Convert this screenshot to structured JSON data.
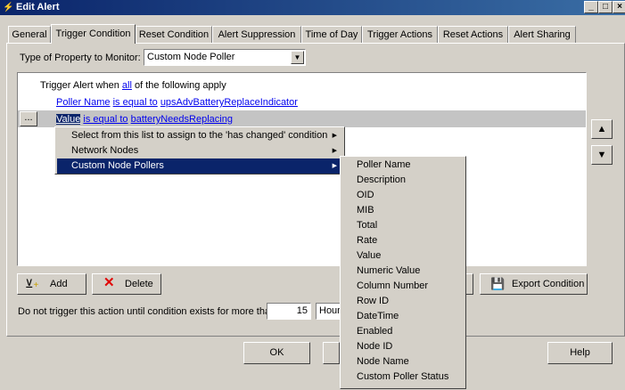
{
  "window": {
    "title": "Edit Alert",
    "minimize": "_",
    "maximize": "□",
    "close": "×"
  },
  "tabs": [
    {
      "label": "General"
    },
    {
      "label": "Trigger Condition"
    },
    {
      "label": "Reset Condition"
    },
    {
      "label": "Alert Suppression"
    },
    {
      "label": "Time of Day"
    },
    {
      "label": "Trigger Actions"
    },
    {
      "label": "Reset Actions"
    },
    {
      "label": "Alert Sharing"
    }
  ],
  "property": {
    "label": "Type of Property to Monitor:",
    "value": "Custom Node Poller"
  },
  "conditions": {
    "header_pre": "Trigger Alert when ",
    "header_link": "all",
    "header_post": " of the following apply",
    "row1": {
      "field": "Poller Name",
      "op": "is equal to",
      "value": "upsAdvBatteryReplaceIndicator"
    },
    "row2": {
      "field": "Value",
      "op": "is equal to",
      "value": "batteryNeedsReplacing"
    },
    "ellipsis": "..."
  },
  "menu1": [
    {
      "label": "Select from this list to assign to the 'has changed' condition"
    },
    {
      "label": "Network Nodes"
    },
    {
      "label": "Custom Node Pollers"
    }
  ],
  "menu2": [
    {
      "label": "Poller Name"
    },
    {
      "label": "Description"
    },
    {
      "label": "OID"
    },
    {
      "label": "MIB"
    },
    {
      "label": "Total"
    },
    {
      "label": "Rate"
    },
    {
      "label": "Value"
    },
    {
      "label": "Numeric Value"
    },
    {
      "label": "Column Number"
    },
    {
      "label": "Row ID"
    },
    {
      "label": "DateTime"
    },
    {
      "label": "Enabled"
    },
    {
      "label": "Node ID"
    },
    {
      "label": "Node Name"
    },
    {
      "label": "Custom Poller Status"
    }
  ],
  "buttons": {
    "add": "Add",
    "delete": "Delete",
    "export": "Export Condition",
    "ok": "OK",
    "help": "Help"
  },
  "delay": {
    "label": "Do not trigger this action until condition exists for more than",
    "value": "15",
    "unit": "Hours"
  },
  "colors": {
    "title_bar": "#0a246a",
    "highlight": "#0a246a",
    "link": "#0000ee",
    "face": "#d4d0c8"
  }
}
